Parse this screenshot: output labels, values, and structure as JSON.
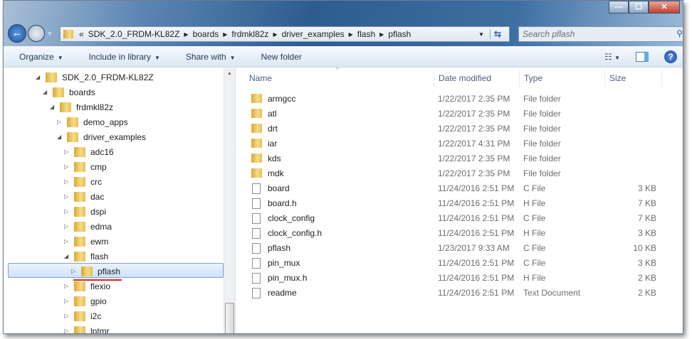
{
  "window": {
    "minimize": "—",
    "maximize": "☐",
    "close": "✕"
  },
  "address": {
    "overflow": "«",
    "crumbs": [
      "SDK_2.0_FRDM-KL82Z",
      "boards",
      "frdmkl82z",
      "driver_examples",
      "flash",
      "pflash"
    ]
  },
  "search": {
    "placeholder": "Search pflash"
  },
  "toolbar": {
    "organize": "Organize",
    "include": "Include in library",
    "share": "Share with",
    "new_folder": "New folder",
    "help": "?"
  },
  "tree": [
    {
      "label": "SDK_2.0_FRDM-KL82Z",
      "level": 0,
      "exp": "◢"
    },
    {
      "label": "boards",
      "level": 1,
      "exp": "◢"
    },
    {
      "label": "frdmkl82z",
      "level": 2,
      "exp": "◢"
    },
    {
      "label": "demo_apps",
      "level": 3,
      "exp": "▷"
    },
    {
      "label": "driver_examples",
      "level": 3,
      "exp": "◢"
    },
    {
      "label": "adc16",
      "level": 4,
      "exp": "▷"
    },
    {
      "label": "cmp",
      "level": 4,
      "exp": "▷"
    },
    {
      "label": "crc",
      "level": 4,
      "exp": "▷"
    },
    {
      "label": "dac",
      "level": 4,
      "exp": "▷"
    },
    {
      "label": "dspi",
      "level": 4,
      "exp": "▷"
    },
    {
      "label": "edma",
      "level": 4,
      "exp": "▷"
    },
    {
      "label": "ewm",
      "level": 4,
      "exp": "▷"
    },
    {
      "label": "flash",
      "level": 4,
      "exp": "◢"
    },
    {
      "label": "pflash",
      "level": 5,
      "exp": "▷"
    },
    {
      "label": "flexio",
      "level": 4,
      "exp": "▷"
    },
    {
      "label": "gpio",
      "level": 4,
      "exp": "▷"
    },
    {
      "label": "i2c",
      "level": 4,
      "exp": "▷"
    },
    {
      "label": "lptmr",
      "level": 4,
      "exp": "▷"
    }
  ],
  "columns": {
    "name": "Name",
    "date": "Date modified",
    "type": "Type",
    "size": "Size"
  },
  "files": [
    {
      "name": "armgcc",
      "date": "1/22/2017 2:35 PM",
      "type": "File folder",
      "size": "",
      "folder": true
    },
    {
      "name": "atl",
      "date": "1/22/2017 2:35 PM",
      "type": "File folder",
      "size": "",
      "folder": true
    },
    {
      "name": "drt",
      "date": "1/22/2017 2:35 PM",
      "type": "File folder",
      "size": "",
      "folder": true
    },
    {
      "name": "iar",
      "date": "1/22/2017 4:31 PM",
      "type": "File folder",
      "size": "",
      "folder": true
    },
    {
      "name": "kds",
      "date": "1/22/2017 2:35 PM",
      "type": "File folder",
      "size": "",
      "folder": true
    },
    {
      "name": "mdk",
      "date": "1/22/2017 2:35 PM",
      "type": "File folder",
      "size": "",
      "folder": true
    },
    {
      "name": "board",
      "date": "11/24/2016 2:51 PM",
      "type": "C File",
      "size": "3 KB"
    },
    {
      "name": "board.h",
      "date": "11/24/2016 2:51 PM",
      "type": "H File",
      "size": "7 KB"
    },
    {
      "name": "clock_config",
      "date": "11/24/2016 2:51 PM",
      "type": "C File",
      "size": "7 KB"
    },
    {
      "name": "clock_config.h",
      "date": "11/24/2016 2:51 PM",
      "type": "H File",
      "size": "3 KB"
    },
    {
      "name": "pflash",
      "date": "1/23/2017 9:33 AM",
      "type": "C File",
      "size": "10 KB"
    },
    {
      "name": "pin_mux",
      "date": "11/24/2016 2:51 PM",
      "type": "C File",
      "size": "3 KB"
    },
    {
      "name": "pin_mux.h",
      "date": "11/24/2016 2:51 PM",
      "type": "H File",
      "size": "2 KB"
    },
    {
      "name": "readme",
      "date": "11/24/2016 2:51 PM",
      "type": "Text Document",
      "size": "2 KB"
    }
  ]
}
